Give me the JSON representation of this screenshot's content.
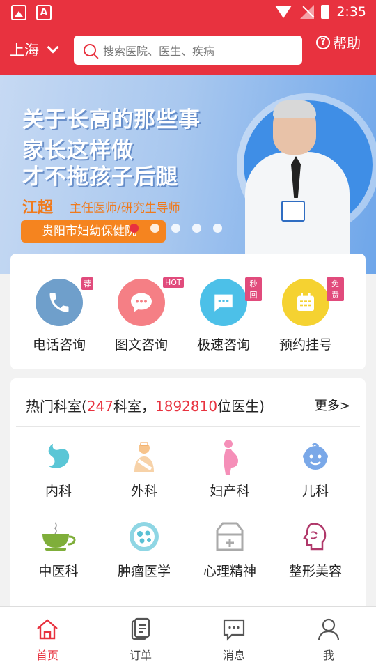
{
  "status_bar": {
    "time": "2:35"
  },
  "header": {
    "city": "上海",
    "search_placeholder": "搜索医院、医生、疾病",
    "help_label": "帮助"
  },
  "banner": {
    "lines": [
      "关于长高的那些事",
      "家长这样做",
      "才不拖孩子后腿"
    ],
    "doctor_name": "江超",
    "doctor_title": "主任医师/研究生导师",
    "hospital": "贵阳市妇幼保健院"
  },
  "quick_actions": [
    {
      "label": "电话咨询",
      "tag": "荐",
      "color": "#6f9fcb",
      "icon": "phone-icon"
    },
    {
      "label": "图文咨询",
      "tag": "HOT",
      "color": "#f57f85",
      "icon": "chat-bubble-icon"
    },
    {
      "label": "极速咨询",
      "tag": "秒回",
      "color": "#4cc0e8",
      "icon": "message-icon"
    },
    {
      "label": "预约挂号",
      "tag": "免费",
      "color": "#f5d231",
      "icon": "calendar-icon"
    }
  ],
  "departments": {
    "title_prefix": "热门科室(",
    "dept_count": "247",
    "title_middle": "科室，",
    "doctor_count": "1892810",
    "title_suffix": "位医生)",
    "more_label": "更多>",
    "items": [
      {
        "label": "内科",
        "icon": "stomach-icon"
      },
      {
        "label": "外科",
        "icon": "bandaged-person-icon"
      },
      {
        "label": "妇产科",
        "icon": "pregnant-woman-icon"
      },
      {
        "label": "儿科",
        "icon": "baby-face-icon"
      },
      {
        "label": "中医科",
        "icon": "herbal-tea-icon"
      },
      {
        "label": "肿瘤医学",
        "icon": "cell-icon"
      },
      {
        "label": "心理精神",
        "icon": "medical-kit-icon"
      },
      {
        "label": "整形美容",
        "icon": "face-profile-icon"
      }
    ]
  },
  "tab_bar": [
    {
      "label": "首页",
      "icon": "home-icon"
    },
    {
      "label": "订单",
      "icon": "order-list-icon"
    },
    {
      "label": "消息",
      "icon": "message-box-icon"
    },
    {
      "label": "我",
      "icon": "person-icon"
    }
  ],
  "colors": {
    "brand_red": "#e8323f",
    "banner_orange": "#f5841f",
    "tag_pink": "#e14b7c"
  }
}
